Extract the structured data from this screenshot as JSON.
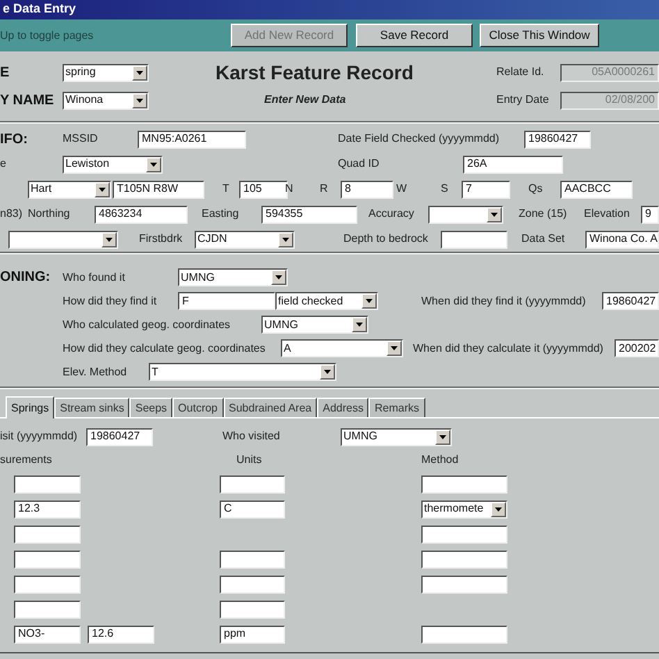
{
  "window": {
    "title": "e Data Entry"
  },
  "toolbar": {
    "hint": "Up to toggle pages",
    "buttons": [
      {
        "label": "Add New Record",
        "disabled": true
      },
      {
        "label": "Save Record",
        "disabled": false
      },
      {
        "label": "Close This Window",
        "disabled": false
      }
    ]
  },
  "header": {
    "rows": [
      {
        "items": [
          {
            "kind": "section",
            "text": "E"
          },
          {
            "kind": "dropdown",
            "value": "spring"
          },
          {
            "kind": "title",
            "text": "Karst Feature Record"
          },
          {
            "kind": "label",
            "text": "Relate Id."
          },
          {
            "kind": "field",
            "value": "05A0000261",
            "disabled": true
          }
        ]
      },
      {
        "items": [
          {
            "kind": "section",
            "text": "Y NAME"
          },
          {
            "kind": "dropdown",
            "value": "Winona"
          },
          {
            "kind": "subtitle",
            "text": "Enter New Data"
          },
          {
            "kind": "label",
            "text": "Entry Date"
          },
          {
            "kind": "field",
            "value": "02/08/200",
            "disabled": true
          }
        ]
      }
    ]
  },
  "info": {
    "rows": [
      {
        "items": [
          {
            "kind": "section",
            "text": "IFO:"
          },
          {
            "kind": "label",
            "text": "MSSID"
          },
          {
            "kind": "field",
            "value": "MN95:A0261"
          },
          {
            "kind": "label",
            "text": "Date Field Checked (yyyymmdd)"
          },
          {
            "kind": "field",
            "value": "19860427"
          }
        ]
      },
      {
        "items": [
          {
            "kind": "label",
            "text": "e"
          },
          {
            "kind": "dropdown",
            "value": "Lewiston"
          },
          {
            "kind": "label",
            "text": "Quad ID"
          },
          {
            "kind": "field",
            "value": "26A"
          }
        ]
      },
      {
        "items": [
          {
            "kind": "dropdown",
            "value": "Hart"
          },
          {
            "kind": "field",
            "value": "T105N R8W"
          },
          {
            "kind": "label",
            "text": "T"
          },
          {
            "kind": "field",
            "value": "105"
          },
          {
            "kind": "label",
            "text": "N"
          },
          {
            "kind": "label",
            "text": "R"
          },
          {
            "kind": "field",
            "value": "8"
          },
          {
            "kind": "label",
            "text": "W"
          },
          {
            "kind": "label",
            "text": "S"
          },
          {
            "kind": "field",
            "value": "7"
          },
          {
            "kind": "label",
            "text": "Qs"
          },
          {
            "kind": "field",
            "value": "AACBCC"
          }
        ]
      },
      {
        "items": [
          {
            "kind": "label",
            "text": "n83)"
          },
          {
            "kind": "label",
            "text": "Northing"
          },
          {
            "kind": "field",
            "value": "4863234"
          },
          {
            "kind": "label",
            "text": "Easting"
          },
          {
            "kind": "field",
            "value": "594355"
          },
          {
            "kind": "label",
            "text": "Accuracy"
          },
          {
            "kind": "dropdown"
          },
          {
            "kind": "label",
            "text": "Zone (15)"
          },
          {
            "kind": "label",
            "text": "Elevation"
          },
          {
            "kind": "field",
            "value": "9"
          }
        ]
      },
      {
        "items": [
          {
            "kind": "dropdown"
          },
          {
            "kind": "label",
            "text": "Firstbdrk"
          },
          {
            "kind": "dropdown",
            "value": "CJDN"
          },
          {
            "kind": "label",
            "text": "Depth to bedrock"
          },
          {
            "kind": "field"
          },
          {
            "kind": "label",
            "text": "Data Set"
          },
          {
            "kind": "field",
            "value": "Winona Co. A"
          }
        ]
      }
    ]
  },
  "positioning": {
    "rows": [
      {
        "items": [
          {
            "kind": "section",
            "text": "ONING:"
          },
          {
            "kind": "label",
            "text": "Who found it"
          },
          {
            "kind": "dropdown",
            "value": "UMNG"
          }
        ]
      },
      {
        "items": [
          {
            "kind": "label",
            "text": "How did they find it"
          },
          {
            "kind": "field",
            "value": "F"
          },
          {
            "kind": "dropdown",
            "value": "field checked"
          },
          {
            "kind": "label",
            "text": "When did they find it (yyyymmdd)"
          },
          {
            "kind": "field",
            "value": "19860427"
          }
        ]
      },
      {
        "items": [
          {
            "kind": "label",
            "text": "Who calculated geog. coordinates"
          },
          {
            "kind": "dropdown",
            "value": "UMNG"
          }
        ]
      },
      {
        "items": [
          {
            "kind": "label",
            "text": "How did they calculate geog. coordinates"
          },
          {
            "kind": "dropdown",
            "value": "A"
          },
          {
            "kind": "label",
            "text": "When did they calculate it (yyyymmdd)"
          },
          {
            "kind": "field",
            "value": "200202"
          }
        ]
      },
      {
        "items": [
          {
            "kind": "label",
            "text": "Elev. Method"
          },
          {
            "kind": "dropdown",
            "value": "T"
          }
        ]
      }
    ]
  },
  "tabs": [
    {
      "label": "Springs",
      "selected": true
    },
    {
      "label": "Stream sinks",
      "selected": false
    },
    {
      "label": "Seeps",
      "selected": false
    },
    {
      "label": "Outcrop",
      "selected": false
    },
    {
      "label": "Subdrained Area",
      "selected": false
    },
    {
      "label": "Address",
      "selected": false
    },
    {
      "label": "Remarks",
      "selected": false
    }
  ],
  "visit": [
    {
      "kind": "label",
      "text": "isit (yyyymmdd)"
    },
    {
      "kind": "field",
      "value": "19860427"
    },
    {
      "kind": "label",
      "text": "Who visited"
    },
    {
      "kind": "dropdown",
      "value": "UMNG"
    }
  ],
  "columns": [
    "surements",
    "Units",
    "Method"
  ],
  "measurements": [
    {
      "measurement": {
        "kind": "field"
      },
      "unit": {
        "kind": "field"
      },
      "method": {
        "kind": "field"
      }
    },
    {
      "measurement": {
        "kind": "field",
        "value": "12.3"
      },
      "unit": {
        "kind": "field",
        "value": "C"
      },
      "method": {
        "kind": "dropdown",
        "value": "thermomete"
      }
    },
    {
      "measurement": {
        "kind": "field"
      },
      "method": {
        "kind": "field"
      }
    },
    {
      "measurement": {
        "kind": "field"
      },
      "unit": {
        "kind": "field"
      },
      "method": {
        "kind": "field"
      }
    },
    {
      "measurement": {
        "kind": "field"
      },
      "unit": {
        "kind": "field"
      },
      "method": {
        "kind": "field"
      }
    },
    {
      "measurement": {
        "kind": "field"
      },
      "unit": {
        "kind": "field"
      }
    },
    {
      "measurement": {
        "kind": "field",
        "value": "NO3-"
      },
      "result": {
        "kind": "field",
        "value": "12.6"
      },
      "unit": {
        "kind": "field",
        "value": "ppm"
      },
      "method": {
        "kind": "field"
      }
    }
  ]
}
